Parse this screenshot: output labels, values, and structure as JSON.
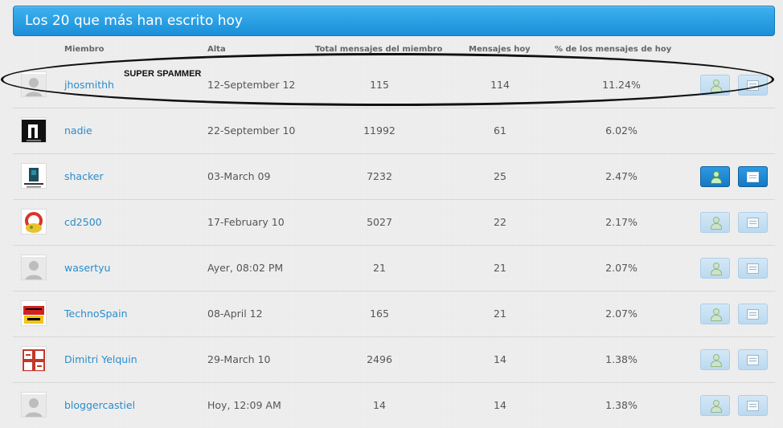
{
  "title": "Los 20 que más han escrito hoy",
  "columns": {
    "member": "Miembro",
    "joined": "Alta",
    "total": "Total mensajes del miembro",
    "today": "Mensajes hoy",
    "pct": "% de los mensajes de hoy"
  },
  "annotation": "SUPER SPAMMER",
  "rows": [
    {
      "name": "jhosmithh",
      "joined": "12-September 12",
      "total": "115",
      "today": "114",
      "pct": "11.24%",
      "avatar": "default-avatar-icon",
      "actions": "disabled"
    },
    {
      "name": "nadie",
      "joined": "22-September 10",
      "total": "11992",
      "today": "61",
      "pct": "6.02%",
      "avatar": "nadie-avatar",
      "actions": "none"
    },
    {
      "name": "shacker",
      "joined": "03-March 09",
      "total": "7232",
      "today": "25",
      "pct": "2.47%",
      "avatar": "shacker-avatar",
      "actions": "enabled"
    },
    {
      "name": "cd2500",
      "joined": "17-February 10",
      "total": "5027",
      "today": "22",
      "pct": "2.17%",
      "avatar": "cd2500-avatar",
      "actions": "disabled"
    },
    {
      "name": "wasertyu",
      "joined": "Ayer, 08:02 PM",
      "total": "21",
      "today": "21",
      "pct": "2.07%",
      "avatar": "default-avatar-icon",
      "actions": "disabled"
    },
    {
      "name": "TechnoSpain",
      "joined": "08-April 12",
      "total": "165",
      "today": "21",
      "pct": "2.07%",
      "avatar": "technospain-avatar",
      "actions": "disabled"
    },
    {
      "name": "Dimitri Yelquin",
      "joined": "29-March 10",
      "total": "2496",
      "today": "14",
      "pct": "1.38%",
      "avatar": "dimitri-avatar",
      "actions": "disabled"
    },
    {
      "name": "bloggercastiel",
      "joined": "Hoy, 12:09 AM",
      "total": "14",
      "today": "14",
      "pct": "1.38%",
      "avatar": "default-avatar-icon",
      "actions": "disabled"
    }
  ],
  "colors": {
    "accent": "#1a8fd8",
    "link": "#2a8ccb"
  }
}
